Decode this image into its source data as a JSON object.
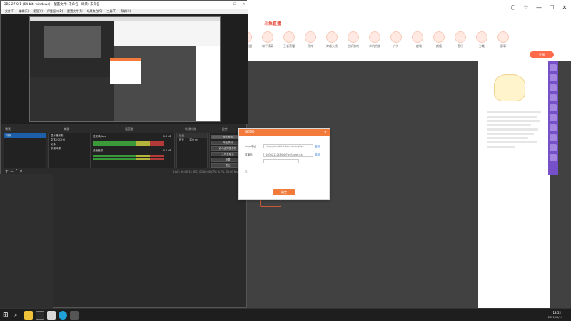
{
  "obs": {
    "title": "OBS 27.0.1 (64-bit, windows) - 配置文件: 未命名 - 场景: 未命名",
    "menus": [
      "文件(F)",
      "编辑(E)",
      "视图(V)",
      "停靠窗口(D)",
      "配置文件(P)",
      "场景集合(S)",
      "工具(T)",
      "帮助(H)"
    ],
    "dock_titles": {
      "scenes": "场景",
      "sources": "来源",
      "mixer": "混音器",
      "transitions": "转场特效",
      "controls": "控件"
    },
    "scenes": [
      "场景"
    ],
    "sources": [
      "显示器采集",
      "文本 (GDI+)",
      "文本",
      "多媒体源"
    ],
    "mixer": [
      {
        "name": "麦克风/Aux",
        "level": "0.0 dB"
      },
      {
        "name": "桌面音频",
        "level": "0.0 dB"
      }
    ],
    "transitions": {
      "type": "淡出",
      "duration_label": "时长",
      "duration": "300 ms"
    },
    "controls": [
      "停止推流",
      "开始录制",
      "启动虚拟摄像机",
      "工作室模式",
      "设置",
      "退出"
    ],
    "status": "LIVE: 00:00:15    REC: 00:00:00    CPU: 4.7%, 30.00 fps",
    "source_panel_title": "未选择源"
  },
  "browser": {
    "site_logo": "斗鱼直播",
    "search": "",
    "categories": [
      "英雄联盟",
      "和平精英",
      "王者荣耀",
      "原神",
      "穿越火线",
      "主机游戏",
      "单机热游",
      "户外",
      "一起看",
      "颜值",
      "音乐",
      "分类",
      "赛事"
    ],
    "live_button": "开播",
    "room_banner": "",
    "player_hint_button": "",
    "player_hint": "",
    "right_text_1": "",
    "right_text_2": "",
    "ranks": [
      "",
      "",
      "",
      "",
      ""
    ]
  },
  "dialog": {
    "title": "推流码",
    "rtmp_label": "rtmp地址",
    "rtmp_value": "rtmp://sendtc3.douyu.com/live",
    "rtmp_copy": "复制",
    "key_label": "直播码",
    "key_value": "10002122t3NyD?wsSecret=a",
    "key_copy": "复制",
    "select_value": "",
    "link": "",
    "note_title": "注：",
    "notes": [
      "",
      "",
      ""
    ],
    "ok": "确定"
  },
  "left_sidebar": {
    "rows": [
      "",
      "",
      "",
      "",
      "",
      "",
      "",
      "",
      "",
      "",
      "",
      "",
      "",
      "",
      "",
      "",
      "",
      "",
      "",
      ""
    ]
  },
  "taskbar": {
    "time": "18:52",
    "date": "2021/12/14"
  }
}
